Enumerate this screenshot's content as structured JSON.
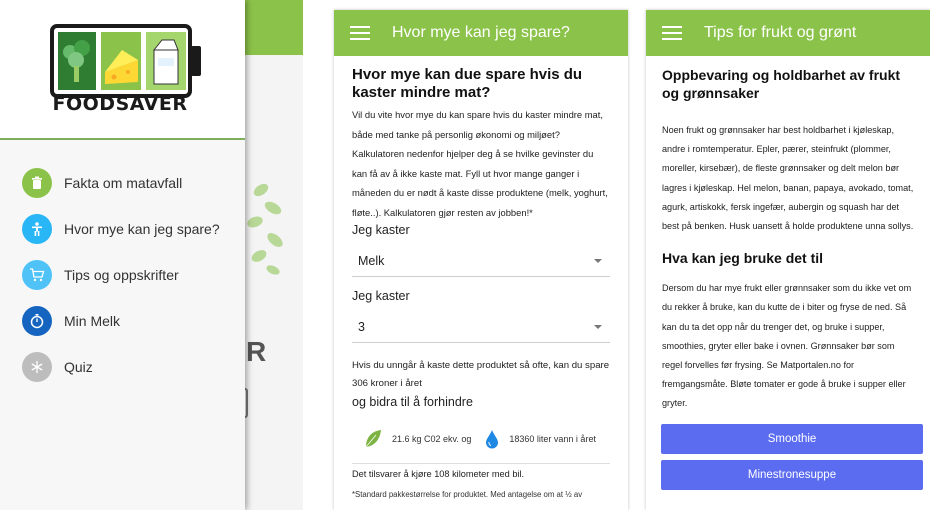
{
  "drawer": {
    "logo_text": "FOODSAVER",
    "logo_icons": [
      "broccoli-icon",
      "cheese-icon",
      "milk-carton-icon"
    ],
    "items": [
      {
        "label": "Fakta om matavfall",
        "icon": "trash-icon",
        "color": "#8bc34a"
      },
      {
        "label": "Hvor mye kan jeg spare?",
        "icon": "person-icon",
        "color": "#29b6f6"
      },
      {
        "label": "Tips og oppskrifter",
        "icon": "cart-icon",
        "color": "#4fc3f7"
      },
      {
        "label": "Min Melk",
        "icon": "timer-icon",
        "color": "#1565c0"
      },
      {
        "label": "Quiz",
        "icon": "snowflake-icon",
        "color": "#bdbdbd"
      }
    ],
    "background_letter": "R"
  },
  "calculator": {
    "title": "Hvor mye kan jeg spare?",
    "heading": "Hvor mye kan due spare hvis du kaster mindre mat?",
    "intro": "Vil du vite hvor mye du kan spare hvis du kaster mindre mat, både med tanke på personlig økonomi og miljøet? Kalkulatoren nedenfor hjelper deg å se hvilke gevinster du kan få av å ikke kaste mat. Fyll ut hvor mange ganger i måneden du er nødt å kaste disse produktene (melk, yoghurt, fløte..). Kalkulatoren gjør resten av jobben!*",
    "field1_label": "Jeg kaster",
    "field1_value": "Melk",
    "field2_label": "Jeg kaster",
    "field2_value": "3",
    "result": "Hvis du unngår å kaste dette produktet så ofte, kan du spare 306 kroner i året",
    "contribute": "og bidra til å forhindre",
    "co2": "21.6 kg C02 ekv. og",
    "water": "18360 liter vann i året",
    "equivalent": "Det tilsvarer å kjøre 108 kilometer med bil.",
    "footnote": "*Standard pakkestørrelse for produktet. Med antagelse om at ½ av produktet blir kastet."
  },
  "tips": {
    "title": "Tips for frukt og grønt",
    "heading": "Oppbevaring og holdbarhet av frukt og grønnsaker",
    "storage_text": "Noen frukt og grønnsaker har best holdbarhet i kjøleskap, andre i romtemperatur. Epler, pærer, steinfrukt (plommer, moreller, kirsebær), de fleste grønnsaker og delt melon bør lagres i kjøleskap. Hel melon, banan, papaya, avokado, tomat, agurk, artiskokk, fersk ingefær, aubergin og squash har det best på benken. Husk uansett å holde produktene unna sollys.",
    "heading2": "Hva kan jeg bruke det til",
    "use_text": "Dersom du har mye frukt eller grønnsaker som du ikke vet om du rekker å bruke, kan du kutte de i biter og fryse de ned. Så kan du ta det opp når du trenger det, og bruke i supper, smoothies, gryter eller bake i ovnen. Grønnsaker bør som regel forvelles før frysing. Se Matportalen.no for fremgangsmåte. Bløte tomater er gode å bruke i supper eller gryter.",
    "button1": "Smoothie",
    "button2": "Minestronesuppe"
  },
  "colors": {
    "appbar_green": "#8bc34a",
    "button_blue": "#5b6cf0"
  }
}
